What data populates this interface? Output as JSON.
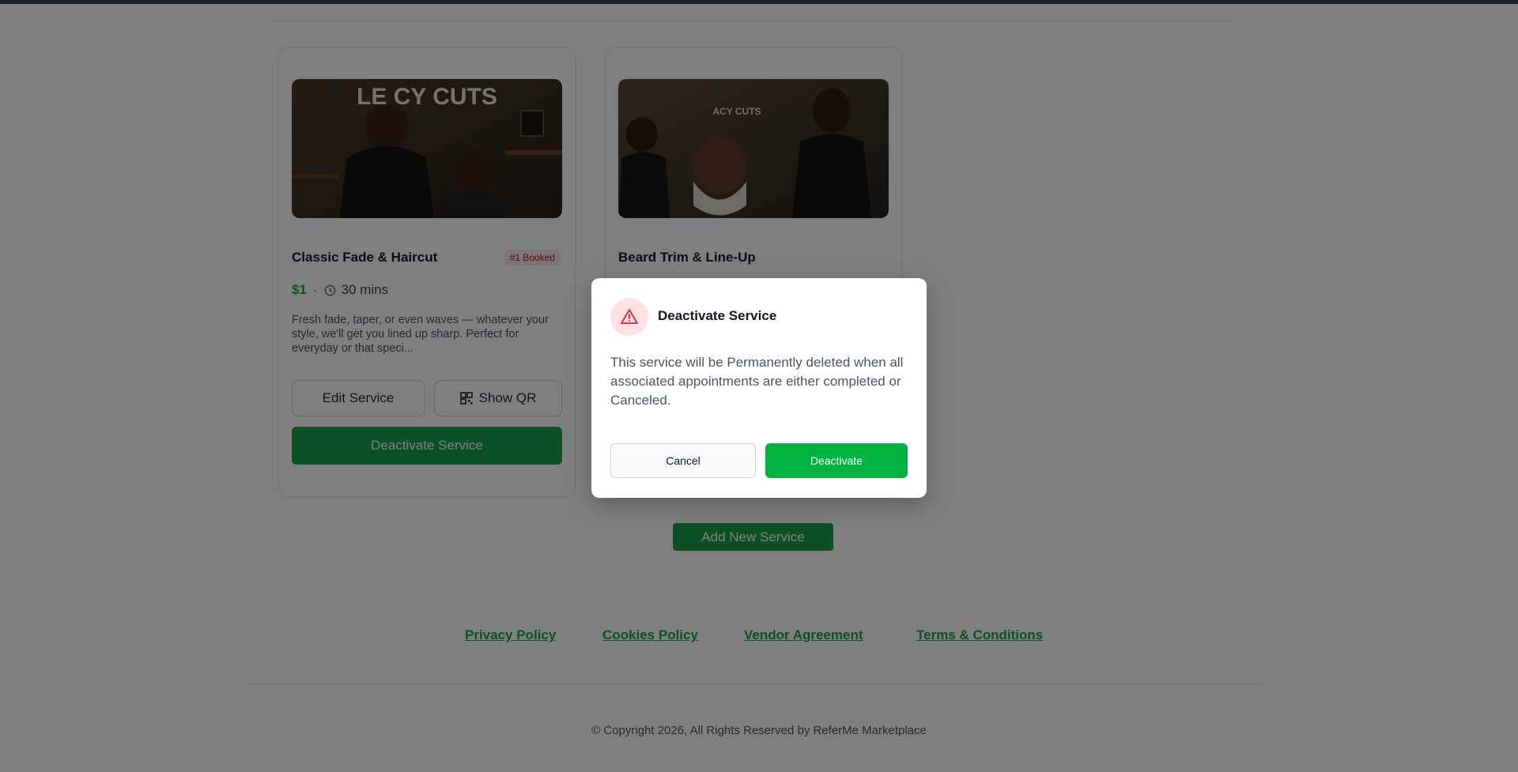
{
  "services": [
    {
      "title": "Classic Fade & Haircut",
      "badge": "#1 Booked",
      "price": "$1",
      "separator": "·",
      "duration": "30 mins",
      "description": "Fresh fade, taper, or even waves — whatever your style, we'll get you lined up sharp. Perfect for everyday or that speci...",
      "image_sign": "LE CY CUTS",
      "edit_label": "Edit Service",
      "qr_label": "Show QR",
      "deactivate_label": "Deactivate Service"
    },
    {
      "title": "Beard Trim & Line-Up",
      "image_sign": "ACY CUTS"
    }
  ],
  "add_service_label": "Add New Service",
  "footer": {
    "links": [
      "Privacy Policy",
      "Cookies Policy",
      "Vendor Agreement",
      "Terms & Conditions"
    ],
    "copyright": "© Copyright 2026, All Rights Reserved by ReferMe Marketplace"
  },
  "modal": {
    "title": "Deactivate Service",
    "body": "This service will be Permanently deleted when all associated appointments are either completed or Canceled.",
    "cancel_label": "Cancel",
    "confirm_label": "Deactivate",
    "icon": "warning-triangle-icon"
  },
  "colors": {
    "accent_green": "#16a34a",
    "confirm_green": "#00b341",
    "danger": "#e11d48",
    "overlay": "rgba(0,0,0,0.5)"
  }
}
